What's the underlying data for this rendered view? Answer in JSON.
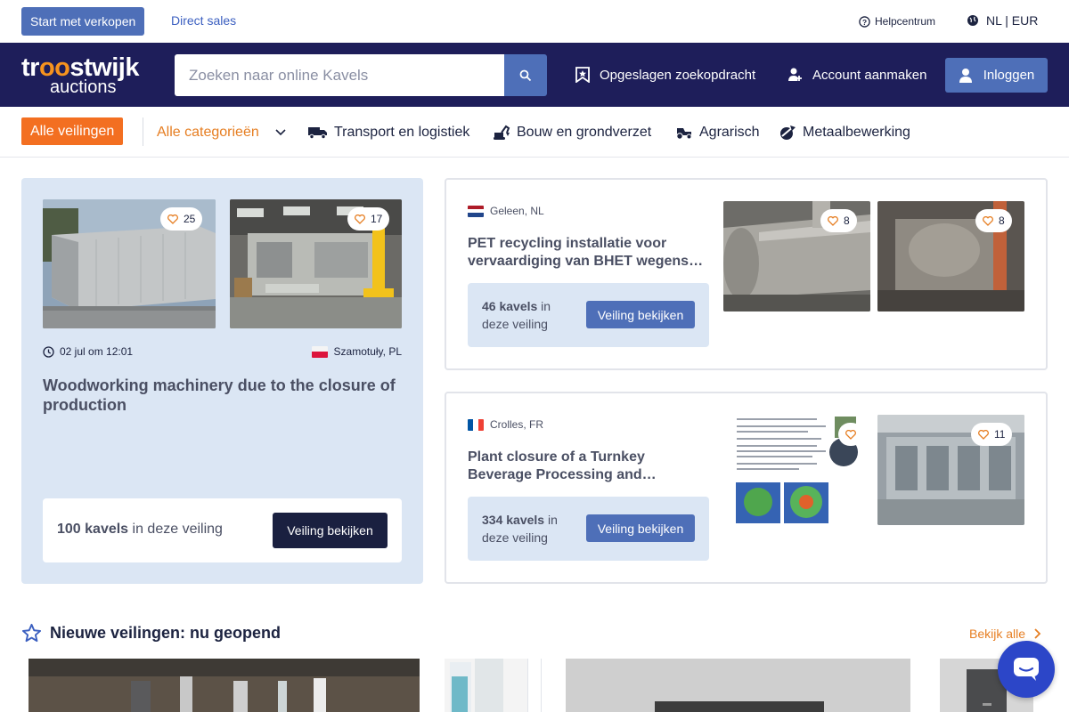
{
  "topbar": {
    "sell_label": "Start met verkopen",
    "direct_label": "Direct sales",
    "help_label": "Helpcentrum",
    "lang_label": "NL | EUR"
  },
  "navbar": {
    "logo_line1a": "tr",
    "logo_line1b": "oo",
    "logo_line1c": "stwijk",
    "logo_line2": "auctions",
    "search_placeholder": "Zoeken naar online Kavels",
    "saved_search": "Opgeslagen zoekopdracht",
    "create_account": "Account aanmaken",
    "login": "Inloggen"
  },
  "catbar": {
    "all_auctions": "Alle veilingen",
    "all_categories": "Alle categorieën",
    "categories": [
      "Transport en logistiek",
      "Bouw en grondverzet",
      "Agrarisch",
      "Metaalbewerking"
    ]
  },
  "featured": {
    "fav1": "25",
    "fav2": "17",
    "date": "02 jul om 12:01",
    "location": "Szamotuły, PL",
    "title": "Woodworking machinery due to the closure of production",
    "count_bold": "100 kavels",
    "count_rest": " in deze veiling",
    "button": "Veiling bekijken"
  },
  "auctions": [
    {
      "location": "Geleen, NL",
      "title": "PET recycling installatie voor vervaardiging van BHET wegens…",
      "count_bold": "46 kavels",
      "count_rest": " in deze veiling",
      "button": "Veiling bekijken",
      "fav1": "8",
      "fav2": "8"
    },
    {
      "location": "Crolles, FR",
      "title": "Plant closure of a Turnkey Beverage Processing and…",
      "count_bold": "334 kavels",
      "count_rest": " in deze veiling",
      "button": "Veiling bekijken",
      "fav1": "",
      "fav2": "11"
    }
  ],
  "section": {
    "title": "Nieuwe veilingen: nu geopend",
    "see_all": "Bekijk alle"
  },
  "colors": {
    "navy": "#1e1e5a",
    "accent_orange": "#f36f21",
    "button_blue": "#4e6fb8",
    "card_blue": "#dbe6f4"
  }
}
